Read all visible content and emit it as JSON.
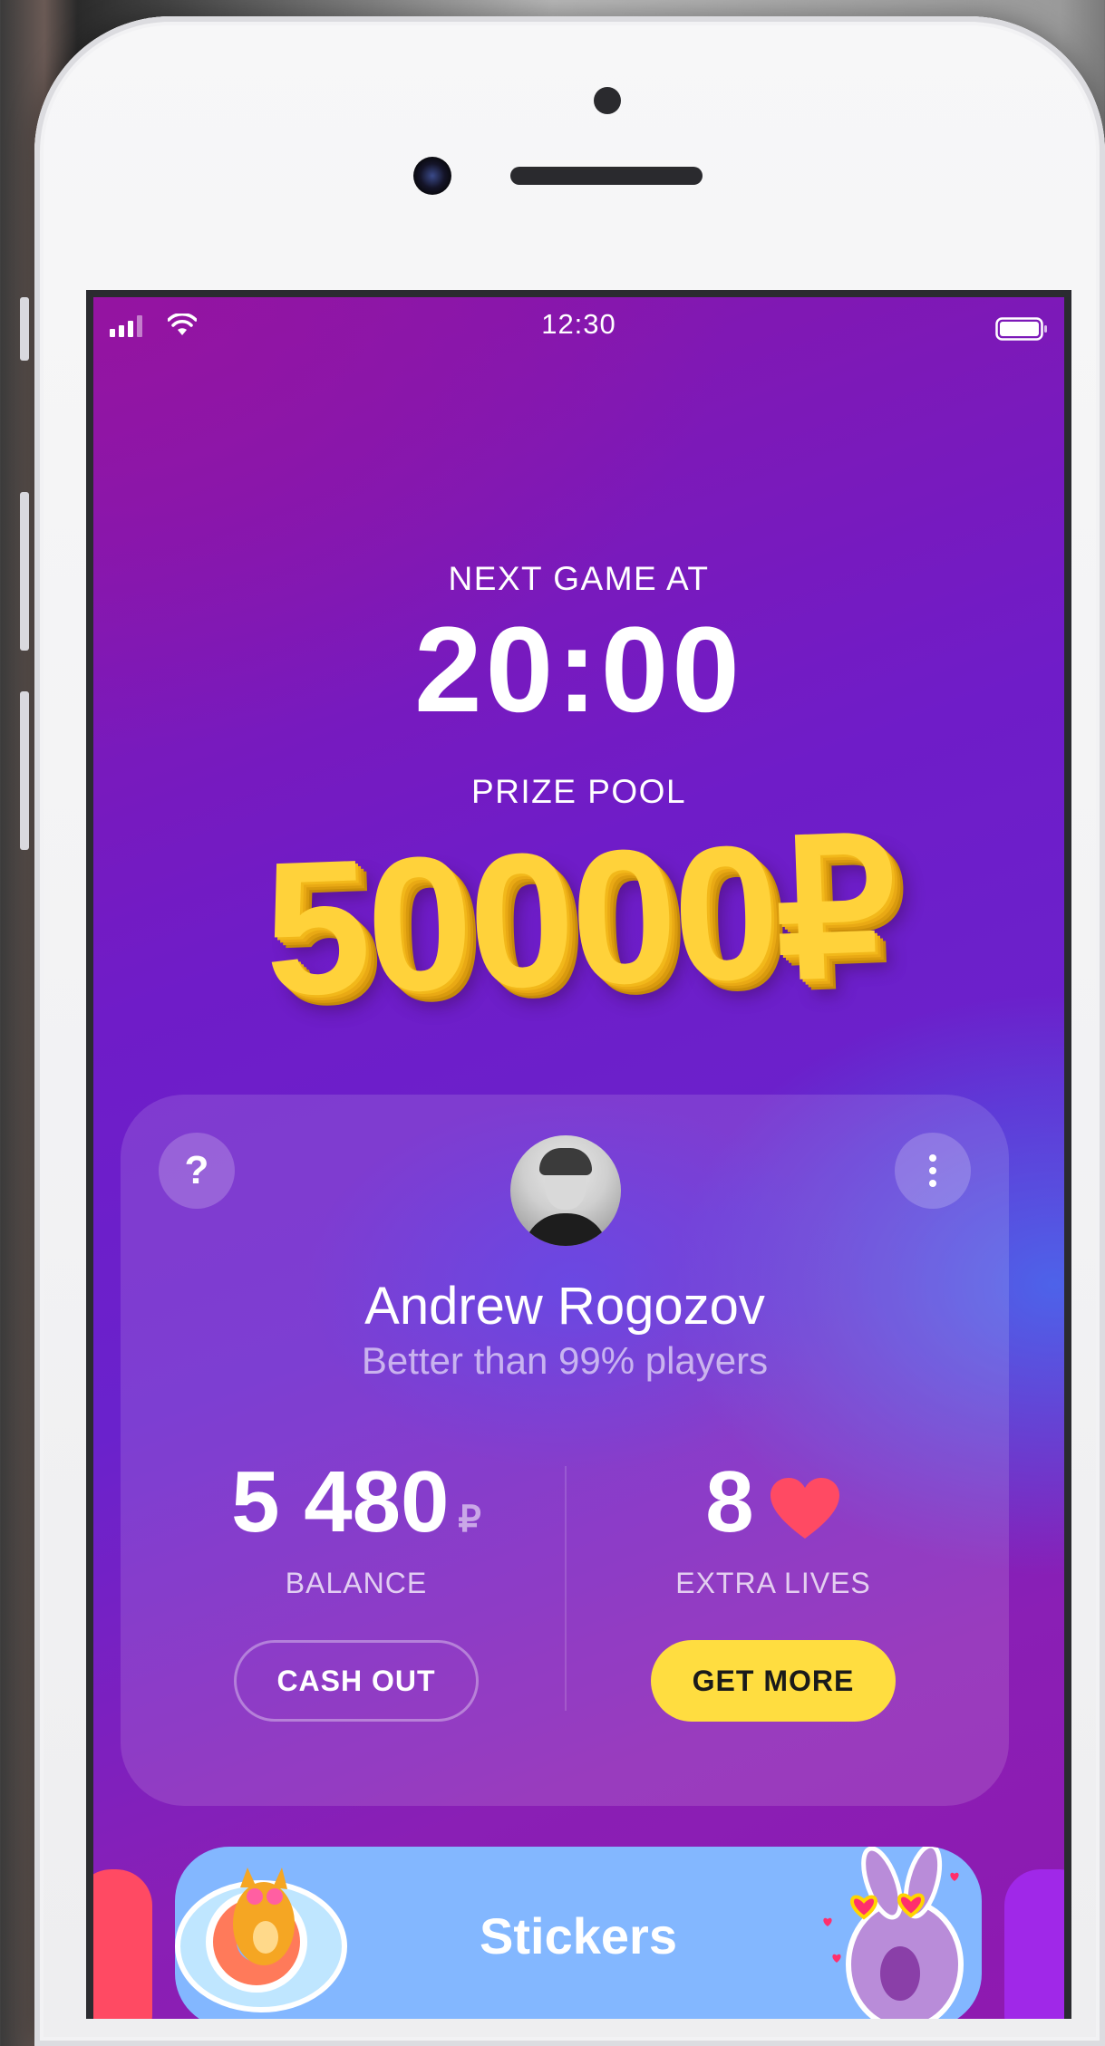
{
  "status_bar": {
    "time": "12:30"
  },
  "game": {
    "next_label": "NEXT GAME AT",
    "next_time": "20:00",
    "prize_label": "PRIZE POOL",
    "prize_amount": "50000₽"
  },
  "profile": {
    "name": "Andrew Rogozov",
    "subtitle": "Better than 99% players",
    "help_label": "?"
  },
  "balance": {
    "value": "5 480",
    "currency": "₽",
    "label": "BALANCE",
    "button": "CASH OUT"
  },
  "lives": {
    "value": "8",
    "label": "EXTRA LIVES",
    "button": "GET MORE"
  },
  "stickers": {
    "title": "Stickers"
  },
  "colors": {
    "accent_yellow": "#ffdd40",
    "heart_red": "#ff4a63",
    "sticker_tile": "#83b7ff",
    "background_purple": "#7a1cc0"
  },
  "icons": [
    "signal-icon",
    "wifi-icon",
    "battery-icon",
    "help-icon",
    "more-icon",
    "heart-icon"
  ]
}
